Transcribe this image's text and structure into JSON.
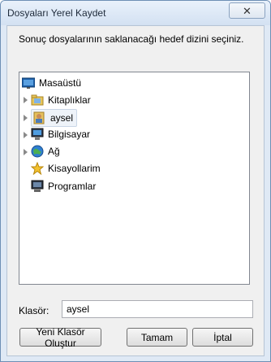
{
  "window": {
    "title": "Dosyaları Yerel Kaydet",
    "close_glyph": "✕"
  },
  "instruction": "Sonuç dosyalarının saklanacağı hedef dizini seçiniz.",
  "tree": {
    "items": [
      {
        "label": "Masaüstü",
        "icon": "desktop-icon"
      },
      {
        "label": "Kitaplıklar",
        "icon": "libraries-icon"
      },
      {
        "label": "aysel",
        "icon": "user-folder-icon",
        "selected": true
      },
      {
        "label": "Bilgisayar",
        "icon": "computer-icon"
      },
      {
        "label": "Ağ",
        "icon": "network-icon"
      },
      {
        "label": "Kisayollarim",
        "icon": "star-icon"
      },
      {
        "label": "Programlar",
        "icon": "monitor-icon"
      }
    ]
  },
  "folder": {
    "label": "Klasör:",
    "value": "aysel"
  },
  "buttons": {
    "new_folder": "Yeni Klasör Oluştur",
    "ok": "Tamam",
    "cancel": "İptal"
  }
}
